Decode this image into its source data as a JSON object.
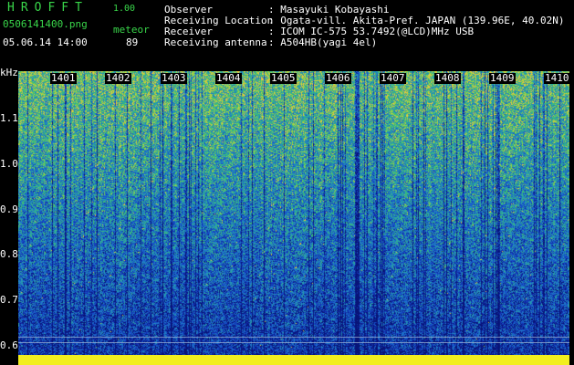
{
  "header": {
    "app_title": "HROFFT",
    "app_version": "1.00",
    "filename": "0506141400.png",
    "meteor_label": "meteor",
    "datetime": "05.06.14 14:00",
    "meteor_count": "89",
    "info": [
      {
        "label": "Observer",
        "value": ": Masayuki Kobayashi"
      },
      {
        "label": "Receiving Location",
        "value": ": Ogata-vill. Akita-Pref. JAPAN (139.96E, 40.02N)"
      },
      {
        "label": "Receiver",
        "value": ": ICOM IC-575 53.7492(@LCD)MHz USB"
      },
      {
        "label": "Receiving antenna",
        "value": ": A504HB(yagi 4el)"
      }
    ]
  },
  "plot": {
    "y_unit": "kHz",
    "x_ticks": [
      "1401",
      "1402",
      "1403",
      "1404",
      "1405",
      "1406",
      "1407",
      "1408",
      "1409",
      "1410"
    ],
    "y_ticks": [
      "1.1",
      "1.0",
      "0.9",
      "0.8",
      "0.7",
      "0.6"
    ]
  }
}
